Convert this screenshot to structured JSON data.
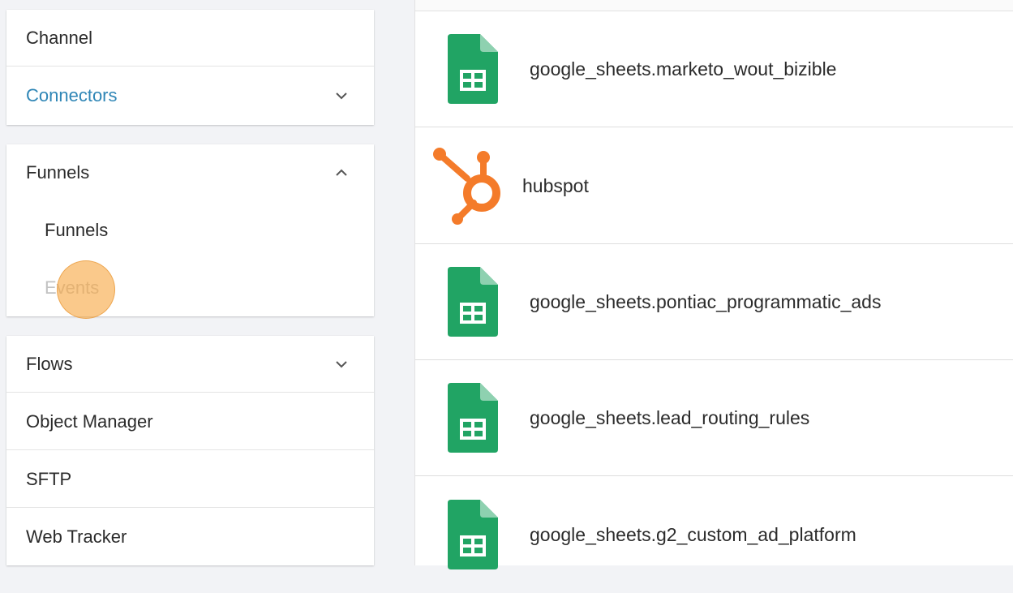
{
  "sidebar": {
    "group1": {
      "channel": "Channel",
      "connectors": "Connectors"
    },
    "funnels": {
      "header": "Funnels",
      "items": [
        "Funnels",
        "Events"
      ]
    },
    "group3": {
      "flows": "Flows",
      "object_manager": "Object Manager",
      "sftp": "SFTP",
      "web_tracker": "Web Tracker"
    }
  },
  "connectors": [
    {
      "name": "google_sheets.marketo_wout_bizible",
      "icon": "google-sheets-icon"
    },
    {
      "name": "hubspot",
      "icon": "hubspot-icon"
    },
    {
      "name": "google_sheets.pontiac_programmatic_ads",
      "icon": "google-sheets-icon"
    },
    {
      "name": "google_sheets.lead_routing_rules",
      "icon": "google-sheets-icon"
    },
    {
      "name": "google_sheets.g2_custom_ad_platform",
      "icon": "google-sheets-icon"
    }
  ],
  "colors": {
    "link": "#2f86b6",
    "sheets_green": "#21a464",
    "hubspot_orange": "#f47b2a",
    "cursor_highlight": "#f7a844"
  }
}
